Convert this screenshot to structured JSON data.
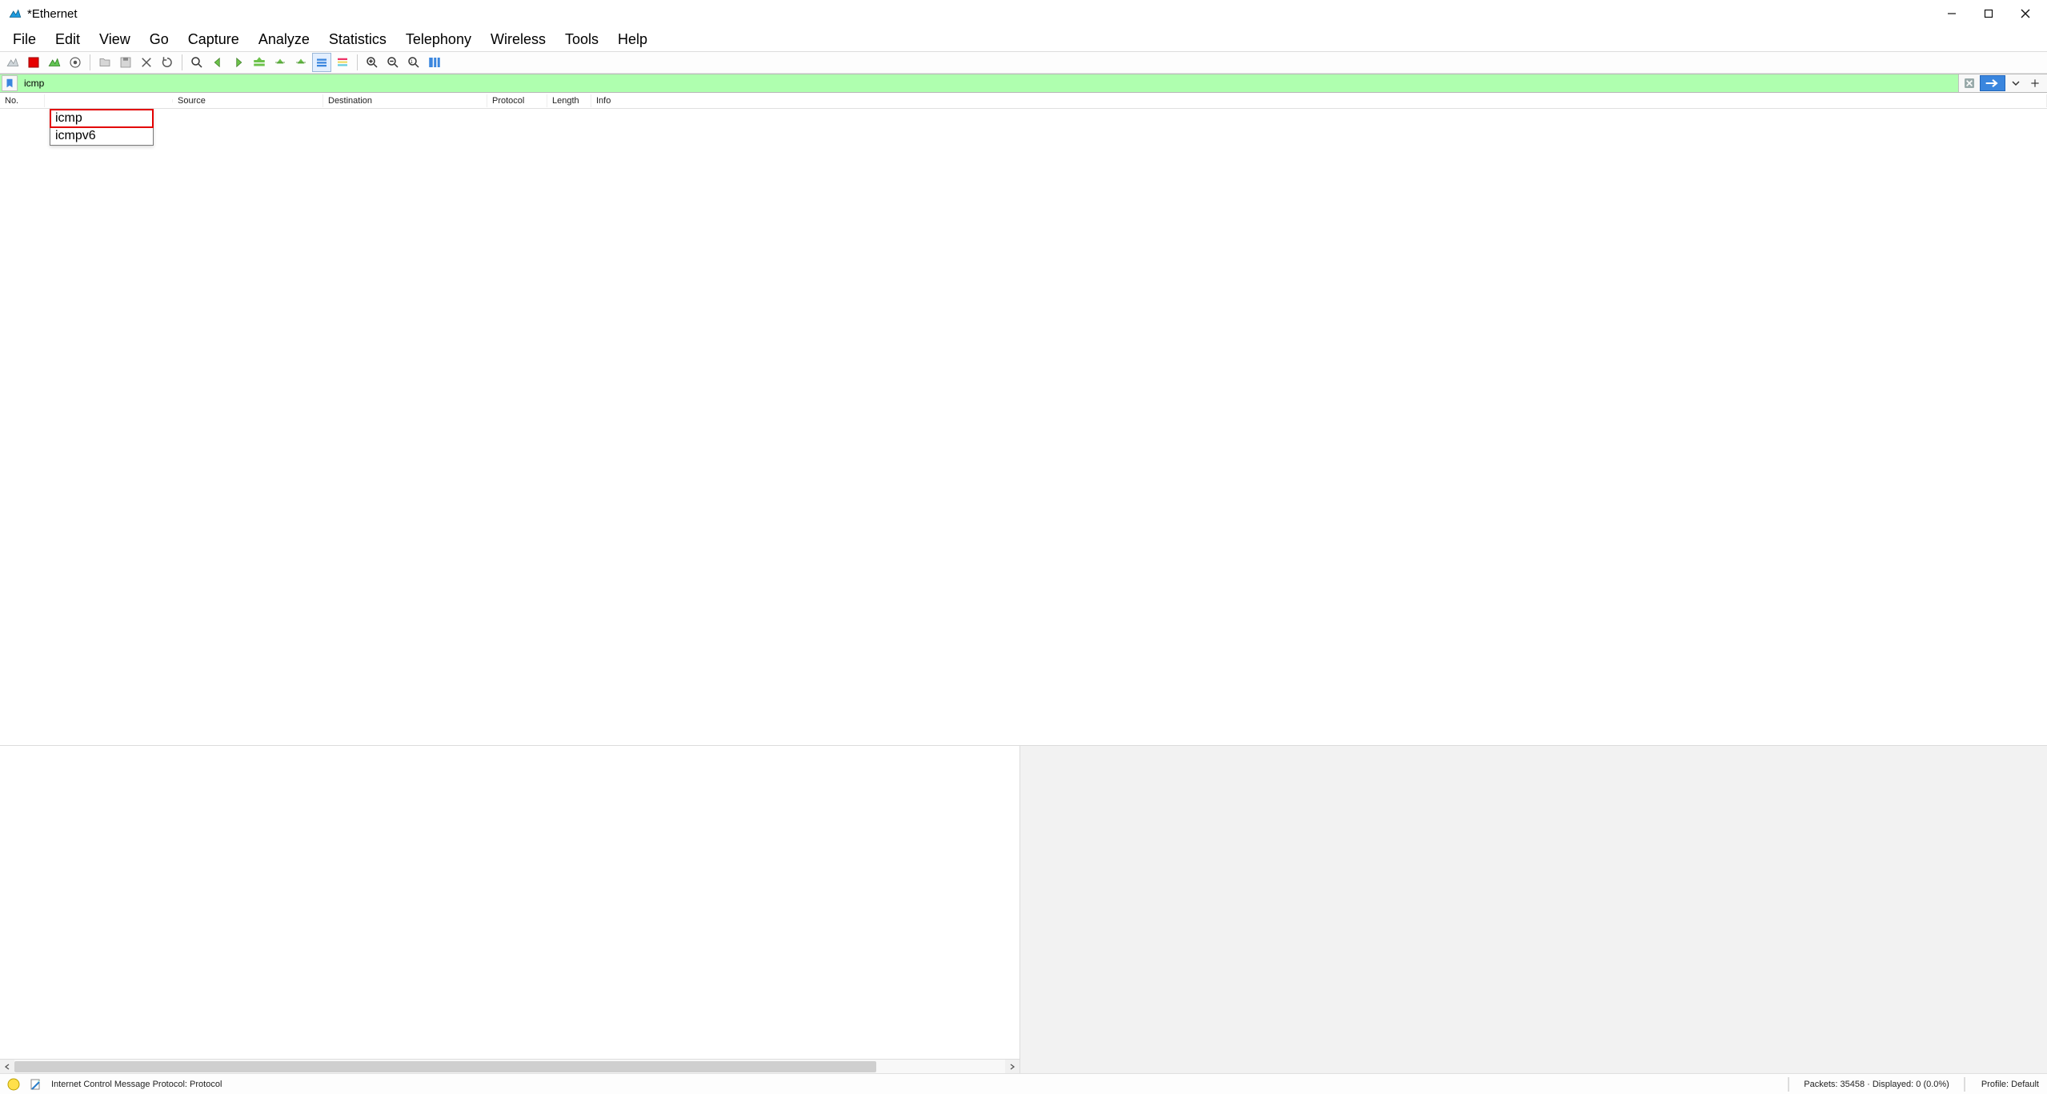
{
  "window": {
    "title": "*Ethernet"
  },
  "menubar": [
    "File",
    "Edit",
    "View",
    "Go",
    "Capture",
    "Analyze",
    "Statistics",
    "Telephony",
    "Wireless",
    "Tools",
    "Help"
  ],
  "filter": {
    "value": "icmp",
    "suggestions": [
      "icmp",
      "icmpv6"
    ]
  },
  "columns": [
    "No.",
    "",
    "Source",
    "Destination",
    "Protocol",
    "Length",
    "Info"
  ],
  "statusbar": {
    "proto_desc": "Internet Control Message Protocol: Protocol",
    "packets": "Packets: 35458 · Displayed: 0 (0.0%)",
    "profile": "Profile: Default"
  }
}
